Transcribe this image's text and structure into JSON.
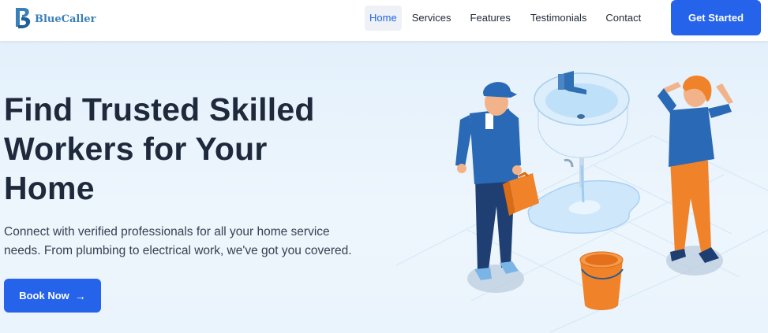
{
  "brand": {
    "name": "BlueCaller",
    "logo_icon": "b-monogram-icon"
  },
  "nav": {
    "items": [
      {
        "label": "Home",
        "active": true
      },
      {
        "label": "Services",
        "active": false
      },
      {
        "label": "Features",
        "active": false
      },
      {
        "label": "Testimonials",
        "active": false
      },
      {
        "label": "Contact",
        "active": false
      }
    ],
    "cta_label": "Get Started"
  },
  "hero": {
    "title_line1": "Find Trusted Skilled",
    "title_line2": "Workers for Your",
    "title_line3": "Home",
    "subtitle_line1": "Connect with verified professionals for all your home service",
    "subtitle_line2": "needs. From plumbing to electrical work, we've got you covered.",
    "button_label": "Book Now",
    "button_icon": "arrow-right-icon",
    "illustration": "plumber-leaking-sink-illustration"
  },
  "colors": {
    "accent": "#2563eb",
    "brand_text": "#3a7fb8",
    "heading": "#1e293b",
    "hero_bg": "#eaf4fc"
  }
}
